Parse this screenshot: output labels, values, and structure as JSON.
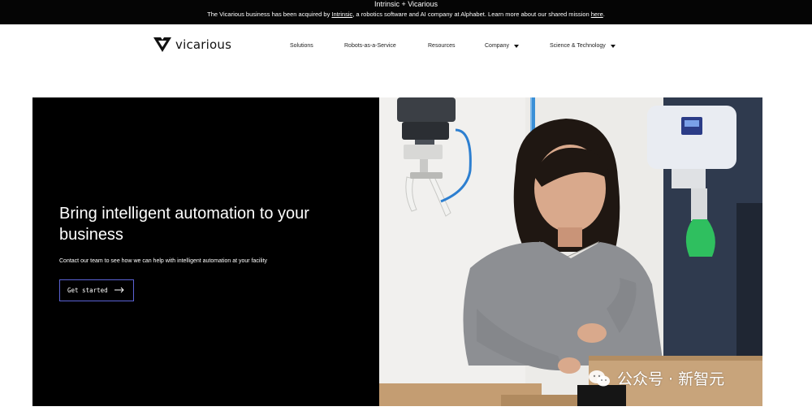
{
  "banner": {
    "title": "Intrinsic + Vicarious",
    "text_before": "The Vicarious business has been acquired by ",
    "link_intrinsic": "Intrinsic",
    "text_middle": ", a robotics software and AI company at Alphabet. Learn more about our shared mission ",
    "link_here": "here",
    "text_after": "."
  },
  "nav": {
    "logo_text": "vicarious",
    "items": [
      {
        "label": "Solutions",
        "has_dropdown": false
      },
      {
        "label": "Robots-as-a-Service",
        "has_dropdown": false
      },
      {
        "label": "Resources",
        "has_dropdown": false
      },
      {
        "label": "Company",
        "has_dropdown": true
      },
      {
        "label": "Science & Technology",
        "has_dropdown": true
      }
    ]
  },
  "hero": {
    "title": "Bring intelligent automation to your business",
    "subtitle": "Contact our team to see how we can help with intelligent automation at your facility",
    "cta_label": "Get started",
    "image_icon": "photo-woman-with-robots"
  },
  "watermark": {
    "text": "公众号 · 新智元",
    "icon": "wechat-icon"
  },
  "colors": {
    "banner_bg": "#050505",
    "hero_bg": "#000000",
    "cta_border": "#5b63d6",
    "robot_green": "#2fbf5f"
  }
}
